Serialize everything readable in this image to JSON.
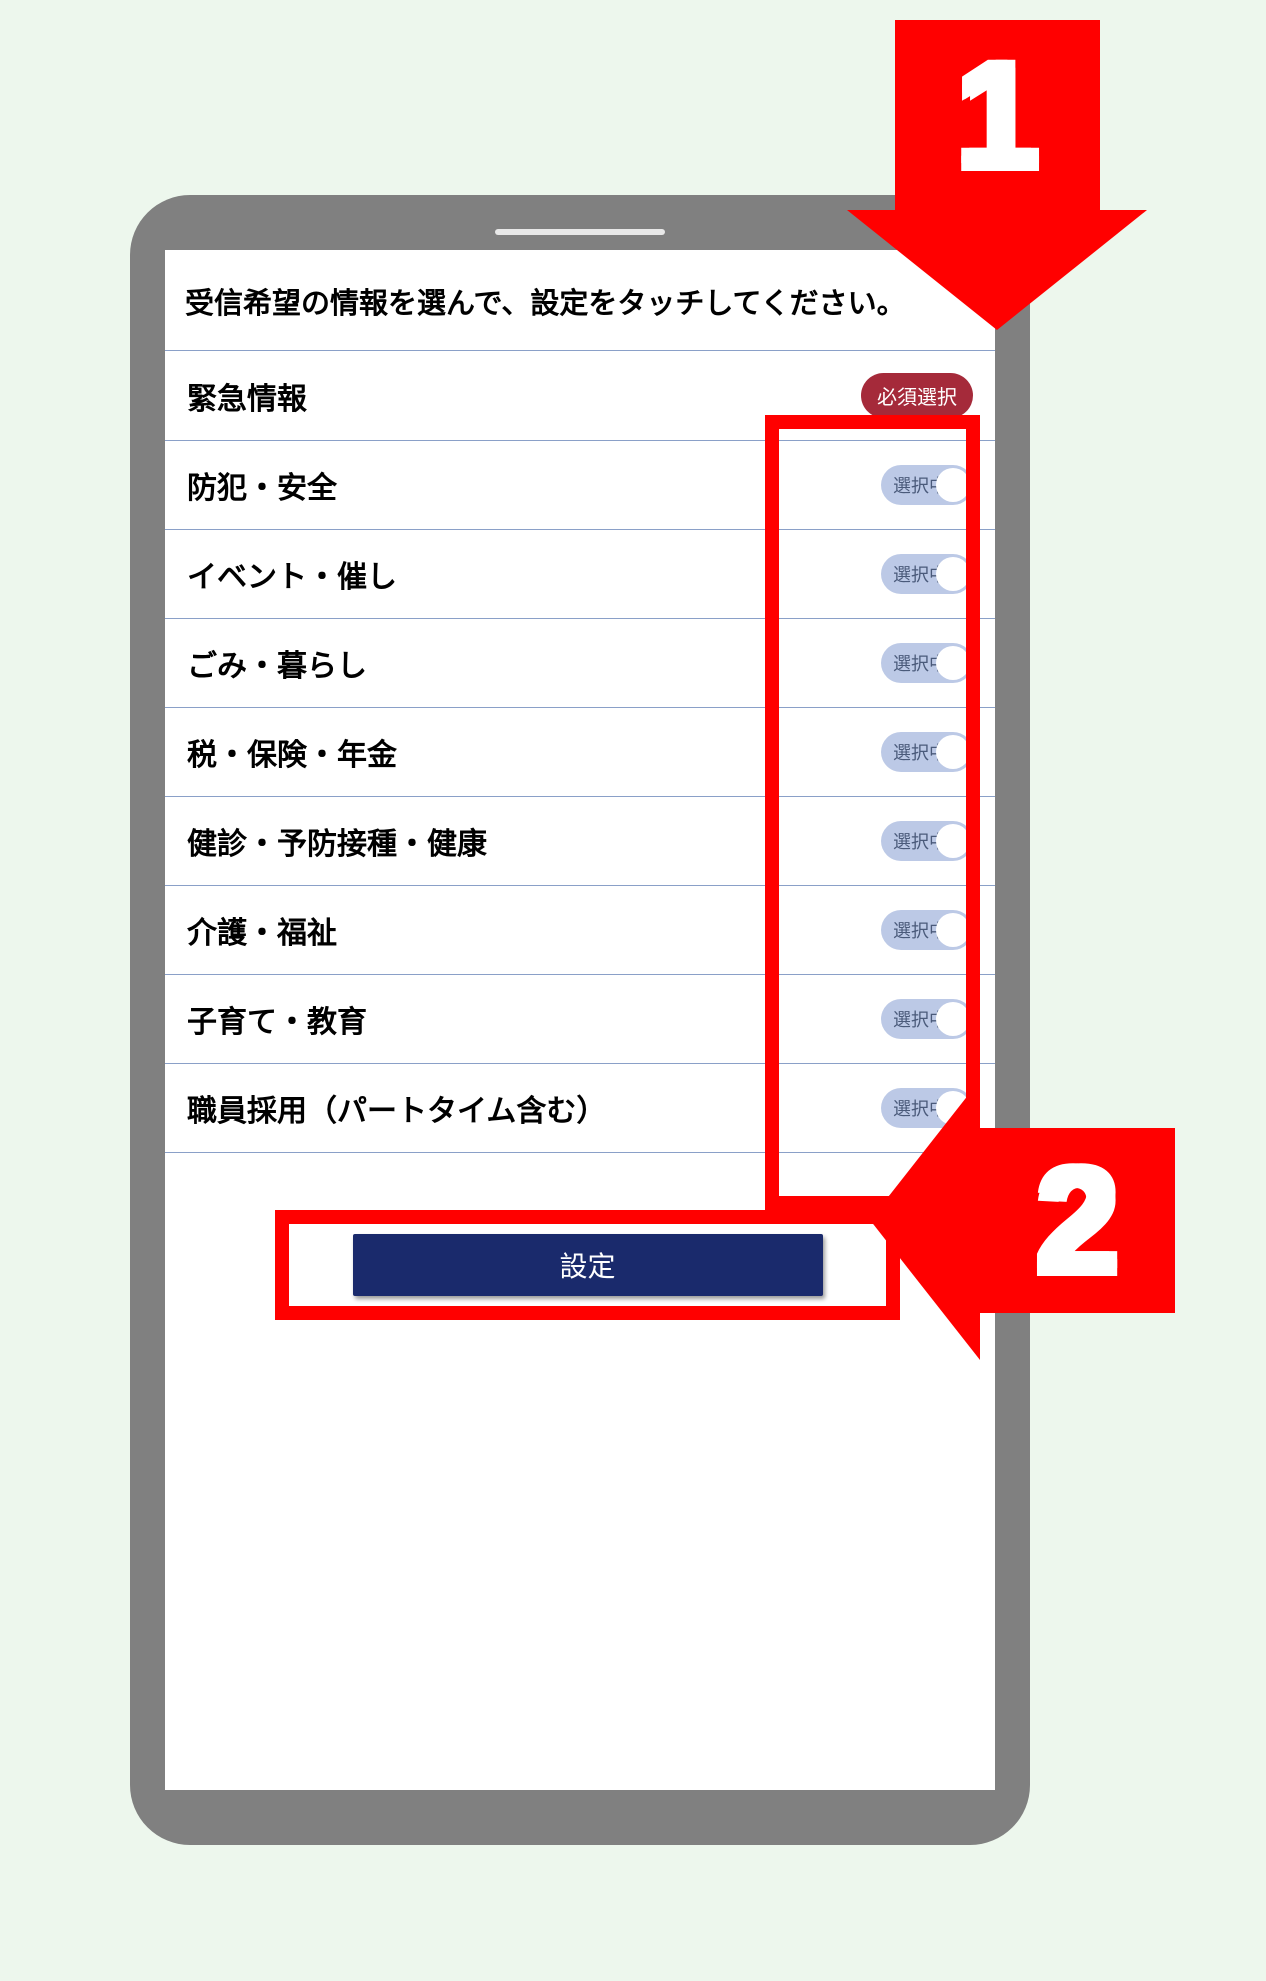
{
  "instruction": "受信希望の情報を選んで、設定をタッチしてください。",
  "required_badge": "必須選択",
  "toggle_text": "選択中",
  "categories": [
    {
      "label": "緊急情報",
      "required": true
    },
    {
      "label": "防犯・安全",
      "required": false
    },
    {
      "label": "イベント・催し",
      "required": false
    },
    {
      "label": "ごみ・暮らし",
      "required": false
    },
    {
      "label": "税・保険・年金",
      "required": false
    },
    {
      "label": "健診・予防接種・健康",
      "required": false
    },
    {
      "label": "介護・福祉",
      "required": false
    },
    {
      "label": "子育て・教育",
      "required": false
    },
    {
      "label": "職員採用（パートタイム含む）",
      "required": false
    }
  ],
  "submit_label": "設定",
  "callouts": {
    "step1": "1",
    "step2": "2"
  }
}
